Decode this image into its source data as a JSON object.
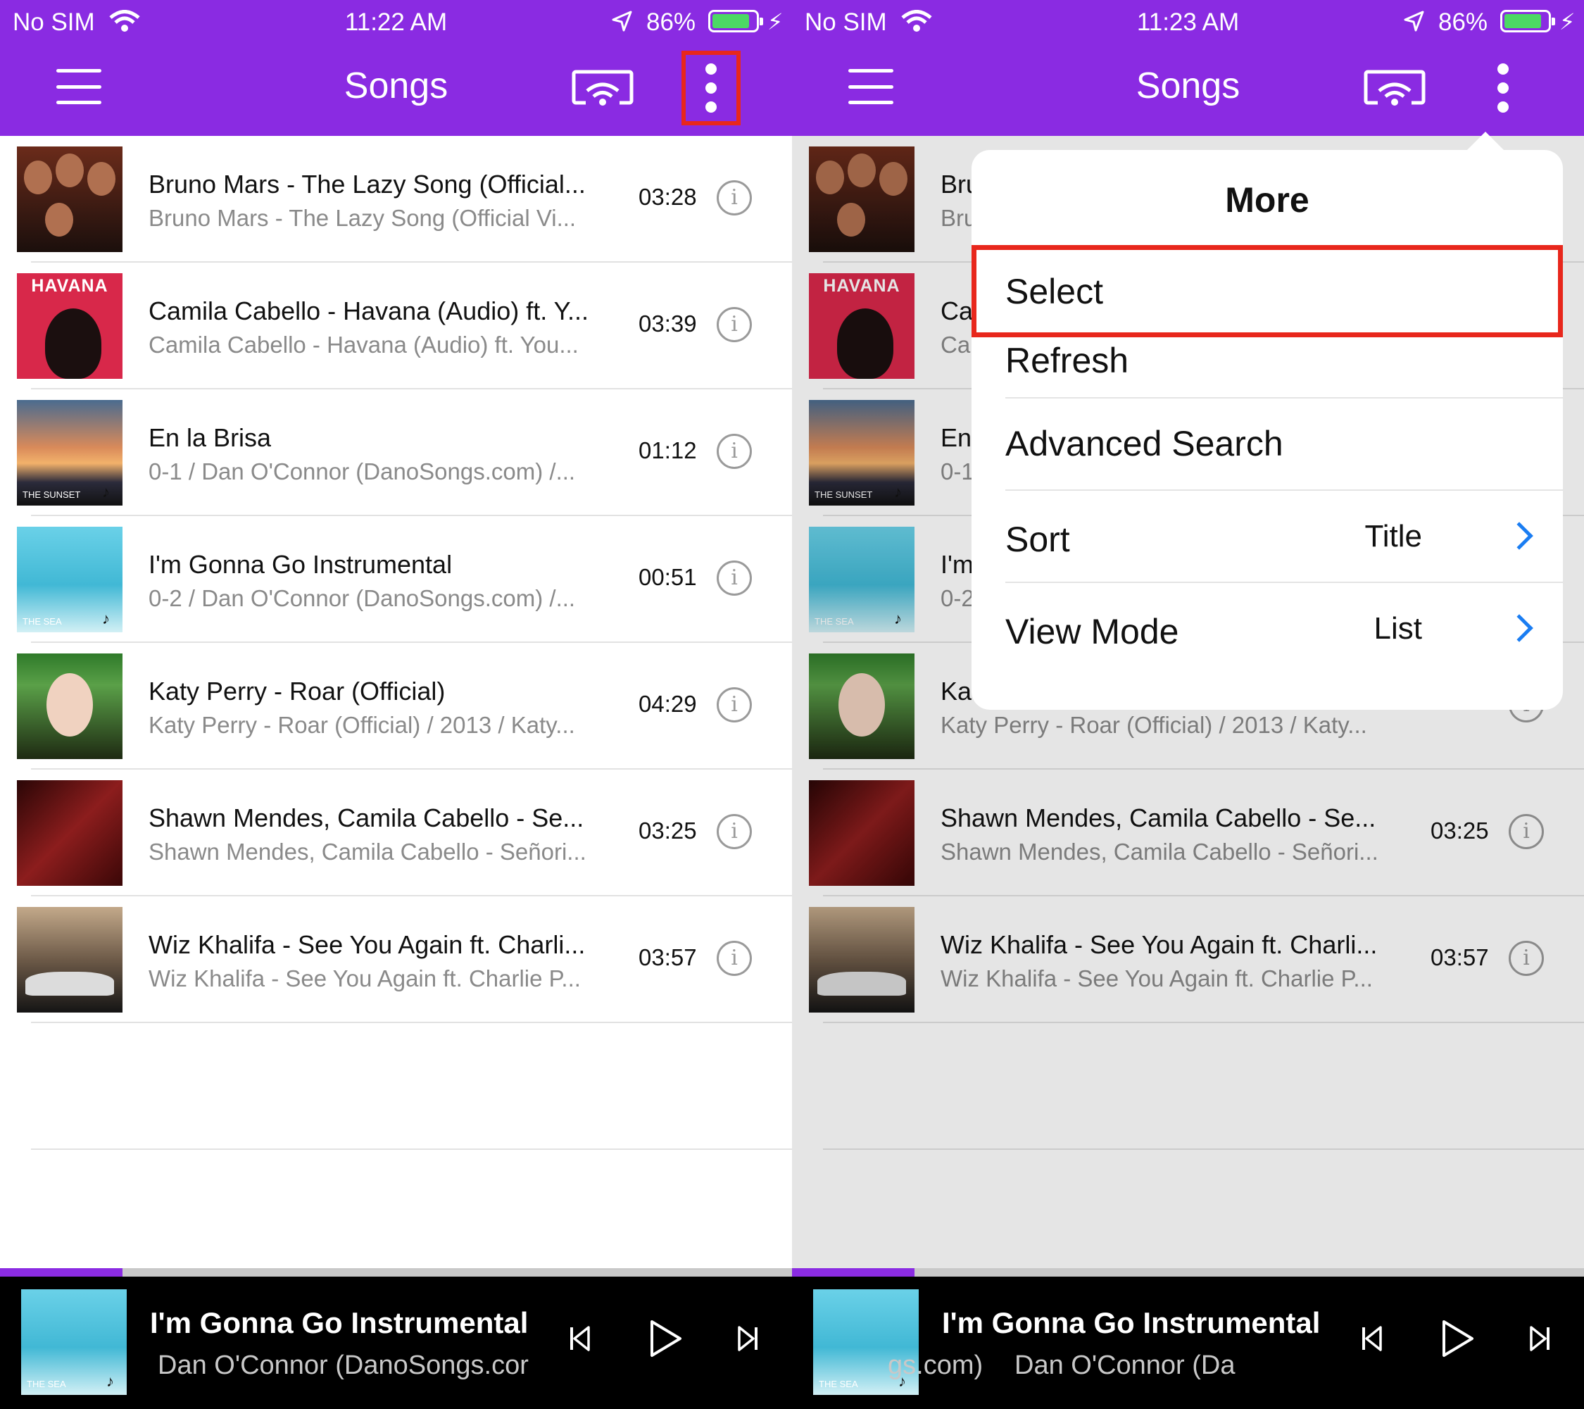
{
  "screens": [
    {
      "status": {
        "carrier": "No SIM",
        "time": "11:22 AM",
        "battery_pct": "86%",
        "battery_level": 0.86
      },
      "header": {
        "title": "Songs"
      },
      "songs": [
        {
          "title": "Bruno Mars - The Lazy Song (Official...",
          "subtitle": "Bruno Mars - The Lazy Song (Official Vi...",
          "duration": "03:28"
        },
        {
          "title": "Camila Cabello - Havana (Audio) ft. Y...",
          "subtitle": "Camila Cabello - Havana (Audio) ft. You...",
          "duration": "03:39",
          "art_text": "HAVANA"
        },
        {
          "title": "En la Brisa",
          "subtitle": "0-1 / Dan O'Connor (DanoSongs.com) /...",
          "duration": "01:12",
          "art_text": "THE SUNSET"
        },
        {
          "title": "I'm Gonna Go Instrumental",
          "subtitle": "0-2 / Dan O'Connor (DanoSongs.com) /...",
          "duration": "00:51",
          "art_text": "THE SEA"
        },
        {
          "title": "Katy Perry - Roar (Official)",
          "subtitle": "Katy Perry - Roar (Official) / 2013 / Katy...",
          "duration": "04:29"
        },
        {
          "title": "Shawn Mendes, Camila Cabello - Se...",
          "subtitle": "Shawn Mendes, Camila Cabello - Señori...",
          "duration": "03:25"
        },
        {
          "title": "Wiz Khalifa - See You Again ft. Charli...",
          "subtitle": "Wiz Khalifa - See You Again ft. Charlie P...",
          "duration": "03:57"
        }
      ],
      "player": {
        "title": "I'm Gonna Go Instrumental",
        "artist": "Dan O'Connor (DanoSongs.cor",
        "art_text": "THE SEA",
        "progress": 0.155
      }
    },
    {
      "status": {
        "carrier": "No SIM",
        "time": "11:23 AM",
        "battery_pct": "86%",
        "battery_level": 0.86
      },
      "header": {
        "title": "Songs"
      },
      "songs": [
        {
          "title": "Bru",
          "subtitle": "Bru",
          "duration": ""
        },
        {
          "title": "Ca",
          "subtitle": "Ca",
          "duration": "",
          "art_text": "HAVANA"
        },
        {
          "title": "En",
          "subtitle": "0-1",
          "duration": "",
          "art_text": "THE SUNSET"
        },
        {
          "title": "I'm",
          "subtitle": "0-2",
          "duration": "",
          "art_text": "THE SEA"
        },
        {
          "title": "Ka",
          "subtitle": "Katy Perry - Roar (Official) / 2013 / Katy...",
          "duration": ""
        },
        {
          "title": "Shawn Mendes, Camila Cabello - Se...",
          "subtitle": "Shawn Mendes, Camila Cabello - Señori...",
          "duration": "03:25"
        },
        {
          "title": "Wiz Khalifa - See You Again ft. Charli...",
          "subtitle": "Wiz Khalifa - See You Again ft. Charlie P...",
          "duration": "03:57"
        }
      ],
      "player": {
        "title": "I'm Gonna Go Instrumental",
        "artist_scroll_a": "gs.com)",
        "artist_scroll_b": "Dan O'Connor (Da",
        "art_text": "THE SEA",
        "progress": 0.155
      },
      "popover": {
        "title": "More",
        "items": [
          {
            "label": "Select",
            "value": ""
          },
          {
            "label": "Refresh",
            "value": ""
          },
          {
            "label": "Advanced Search",
            "value": ""
          },
          {
            "label": "Sort",
            "value": "Title"
          },
          {
            "label": "View Mode",
            "value": "List"
          }
        ]
      }
    }
  ],
  "icons": [
    "wifi-icon",
    "location-arrow-icon",
    "battery-icon",
    "charging-bolt-icon",
    "hamburger-menu-icon",
    "cast-icon",
    "more-vertical-icon",
    "info-icon",
    "music-note-icon",
    "previous-track-icon",
    "play-icon",
    "next-track-icon",
    "chevron-right-icon"
  ],
  "colors": {
    "header": "#8a2be2",
    "highlight": "#e8271c",
    "accent_blue": "#1a7df2",
    "battery_green": "#4cd964"
  }
}
